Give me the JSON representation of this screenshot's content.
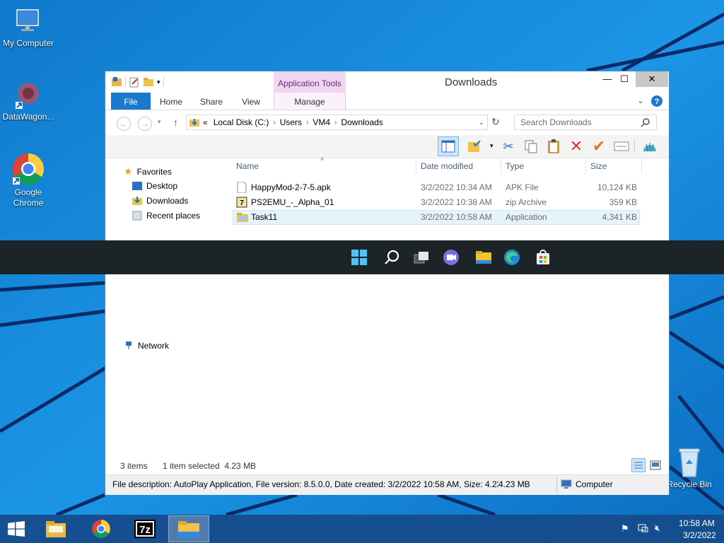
{
  "desktop": {
    "icons": [
      {
        "label": "My Computer",
        "icon": "computer-icon"
      },
      {
        "label": "DataWagon...",
        "icon": "datawagon-icon"
      },
      {
        "label": "Google Chrome",
        "icon": "chrome-icon"
      },
      {
        "label": "Recycle Bin",
        "icon": "recycle-bin-icon"
      }
    ]
  },
  "window": {
    "title": "Downloads",
    "context_tab": "Application Tools",
    "tabs": {
      "file": "File",
      "home": "Home",
      "share": "Share",
      "view": "View",
      "manage": "Manage"
    },
    "address": {
      "prefix": "«",
      "segments": [
        "Local Disk (C:)",
        "Users",
        "VM4",
        "Downloads"
      ]
    },
    "search": {
      "placeholder": "Search Downloads"
    },
    "nav": {
      "favorites": "Favorites",
      "desktop": "Desktop",
      "downloads": "Downloads",
      "recent": "Recent places",
      "network": "Network"
    },
    "columns": {
      "name": "Name",
      "date": "Date modified",
      "type": "Type",
      "size": "Size"
    },
    "files": [
      {
        "name": "HappyMod-2-7-5.apk",
        "date": "3/2/2022 10:34 AM",
        "type": "APK File",
        "size": "10,124 KB"
      },
      {
        "name": "PS2EMU_-_Alpha_01",
        "date": "3/2/2022 10:38 AM",
        "type": "zip Archive",
        "size": "359 KB"
      },
      {
        "name": "Task11",
        "date": "3/2/2022 10:58 AM",
        "type": "Application",
        "size": "4,341 KB"
      }
    ],
    "status": {
      "items": "3 items",
      "selected": "1 item selected  4.23 MB"
    },
    "details": {
      "description": "File description: AutoPlay Application, File version: 8.5.0.0, Date created: 3/2/2022 10:58 AM, Size: 4.23 M",
      "size": "4.23 MB",
      "location": "Computer"
    }
  },
  "tray": {
    "time": "10:58 AM",
    "date": "3/2/2022"
  },
  "colors": {
    "accent": "#1979ca",
    "desktop": "#1a8ad8",
    "taskbar": "#164c8c"
  }
}
